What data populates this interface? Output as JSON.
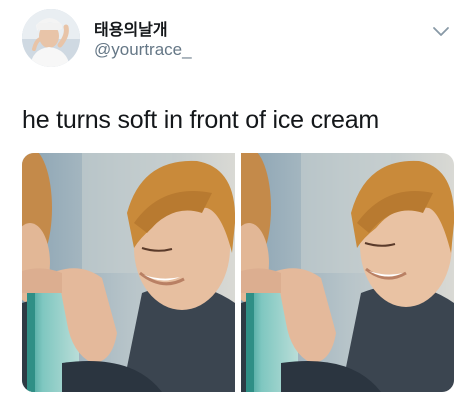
{
  "tweet": {
    "author": {
      "display_name": "태용의날개",
      "handle": "@yourtrace_",
      "avatar_icon": "user-avatar-photo"
    },
    "menu_icon": "chevron-down-icon",
    "text": "he turns soft in front of ice cream",
    "media": [
      {
        "description_icon": "photo-left"
      },
      {
        "description_icon": "photo-right"
      }
    ]
  },
  "colors": {
    "text": "#14171a",
    "secondary": "#657786",
    "accent_hair": "#c98a3a"
  }
}
